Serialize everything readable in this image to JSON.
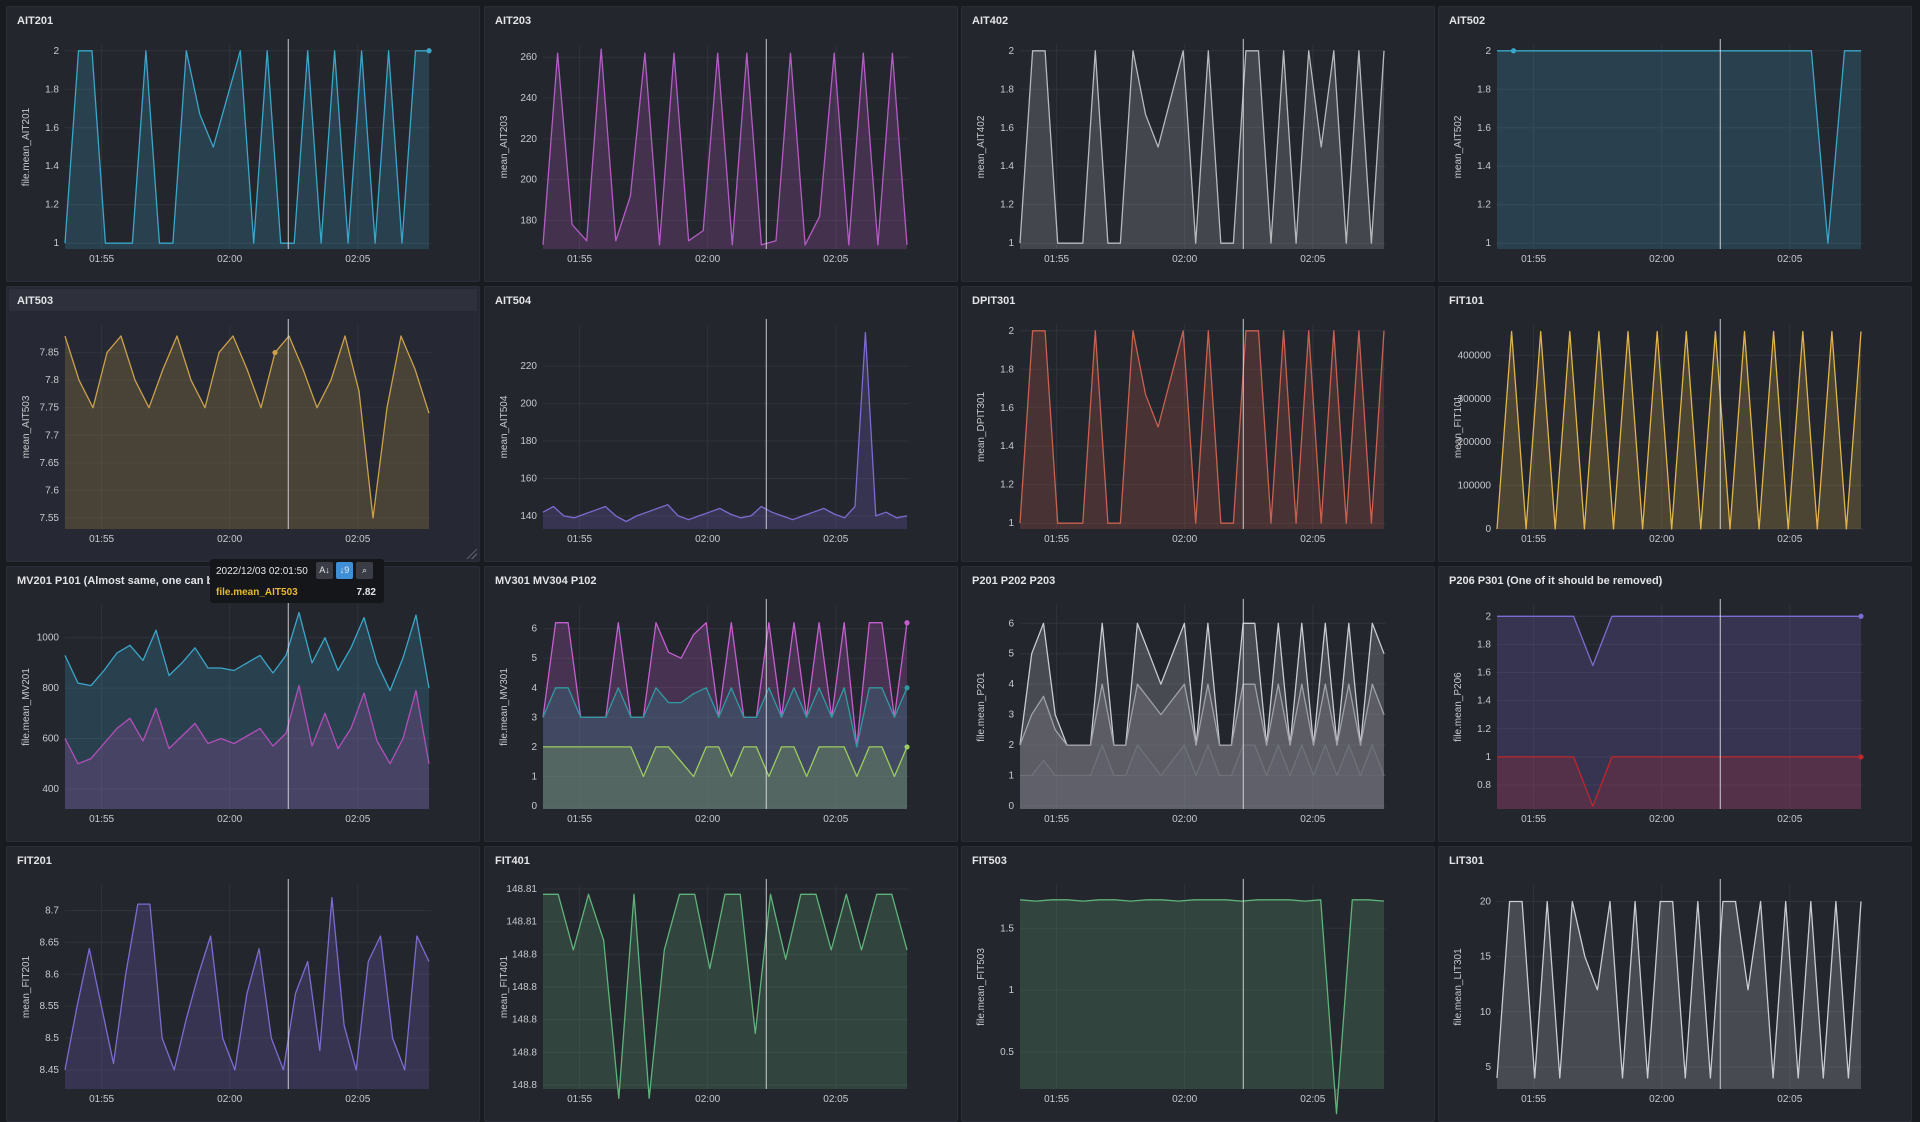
{
  "dashboard": {
    "crosshair_time": "02:02:00"
  },
  "panels": [
    {
      "title": "AIT201",
      "ylabel": "file.mean_AIT201",
      "color": "#3aa6c9",
      "yticks": [
        "2",
        "1.8",
        "1.6",
        "1.4",
        "1.2",
        "1"
      ],
      "xticks": [
        "01:55",
        "02:00",
        "02:05"
      ],
      "series": [
        {
          "values": [
            1,
            2,
            2,
            1,
            1,
            1,
            2,
            1,
            1,
            2,
            1.67,
            1.5,
            1.75,
            2,
            1,
            2,
            1,
            1,
            2,
            1,
            2,
            1,
            2,
            1,
            2,
            1,
            2,
            2
          ]
        }
      ],
      "dot": {
        "series": 0,
        "index": 27
      }
    },
    {
      "title": "AIT203",
      "ylabel": "mean_AIT203",
      "color": "#b45cc4",
      "yticks": [
        "260",
        "240",
        "220",
        "200",
        "180"
      ],
      "xticks": [
        "01:55",
        "02:00",
        "02:05"
      ],
      "series": [
        {
          "values": [
            168,
            262,
            178,
            170,
            264,
            170,
            192,
            262,
            168,
            262,
            170,
            175,
            262,
            168,
            262,
            168,
            170,
            262,
            168,
            182,
            262,
            168,
            262,
            168,
            262,
            168
          ]
        }
      ],
      "ylim": [
        166,
        266
      ]
    },
    {
      "title": "AIT402",
      "ylabel": "mean_AIT402",
      "color": "#b7b9bd",
      "yticks": [
        "2",
        "1.8",
        "1.6",
        "1.4",
        "1.2",
        "1"
      ],
      "xticks": [
        "01:55",
        "02:00",
        "02:05"
      ],
      "series": [
        {
          "values": [
            1,
            2,
            2,
            1,
            1,
            1,
            2,
            1,
            1,
            2,
            1.67,
            1.5,
            1.75,
            2,
            1,
            2,
            1,
            1,
            2,
            2,
            1,
            2,
            1,
            2,
            1.5,
            2,
            1,
            2,
            1,
            2
          ]
        }
      ]
    },
    {
      "title": "AIT502",
      "ylabel": "mean_AIT502",
      "color": "#3aa6c9",
      "yticks": [
        "2",
        "1.8",
        "1.6",
        "1.4",
        "1.2",
        "1"
      ],
      "xticks": [
        "01:55",
        "02:00",
        "02:05"
      ],
      "series": [
        {
          "values": [
            2,
            2,
            2,
            2,
            2,
            2,
            2,
            2,
            2,
            2,
            2,
            2,
            2,
            2,
            2,
            2,
            2,
            2,
            2,
            2,
            1,
            2,
            2
          ]
        }
      ],
      "dot": {
        "series": 0,
        "index": 1
      }
    },
    {
      "title": "AIT503",
      "ylabel": "mean_AIT503",
      "color": "#caa14a",
      "highlight": true,
      "yticks": [
        "7.85",
        "7.8",
        "7.75",
        "7.7",
        "7.65",
        "7.6",
        "7.55"
      ],
      "xticks": [
        "01:55",
        "02:00",
        "02:05"
      ],
      "series": [
        {
          "values": [
            7.88,
            7.8,
            7.75,
            7.85,
            7.88,
            7.8,
            7.75,
            7.82,
            7.88,
            7.8,
            7.75,
            7.85,
            7.88,
            7.82,
            7.75,
            7.85,
            7.88,
            7.82,
            7.75,
            7.8,
            7.88,
            7.78,
            7.55,
            7.75,
            7.88,
            7.82,
            7.74
          ]
        }
      ],
      "dot": {
        "series": 0,
        "index": 15
      },
      "ylim": [
        7.53,
        7.9
      ]
    },
    {
      "title": "AIT504",
      "ylabel": "mean_AIT504",
      "color": "#7c6bd1",
      "yticks": [
        "220",
        "200",
        "180",
        "160",
        "140"
      ],
      "xticks": [
        "01:55",
        "02:00",
        "02:05"
      ],
      "series": [
        {
          "values": [
            142,
            145,
            140,
            139,
            141,
            143,
            145,
            140,
            137,
            140,
            142,
            144,
            146,
            140,
            138,
            140,
            142,
            144,
            141,
            139,
            140,
            145,
            142,
            140,
            138,
            140,
            142,
            144,
            141,
            139,
            145,
            238,
            140,
            142,
            139,
            140
          ]
        }
      ],
      "ylim": [
        133,
        242
      ]
    },
    {
      "title": "DPIT301",
      "ylabel": "mean_DPIT301",
      "color": "#c8614f",
      "yticks": [
        "2",
        "1.8",
        "1.6",
        "1.4",
        "1.2",
        "1"
      ],
      "xticks": [
        "01:55",
        "02:00",
        "02:05"
      ],
      "series": [
        {
          "values": [
            1,
            2,
            2,
            1,
            1,
            1,
            2,
            1,
            1,
            2,
            1.67,
            1.5,
            1.75,
            2,
            1,
            2,
            1,
            1,
            2,
            2,
            1,
            2,
            1,
            2,
            1,
            2,
            1,
            2,
            1,
            2
          ]
        }
      ]
    },
    {
      "title": "FIT101",
      "ylabel": "mean_FIT101",
      "color": "#e0b44a",
      "yticks": [
        "400000",
        "300000",
        "200000",
        "100000",
        "0"
      ],
      "xticks": [
        "01:55",
        "02:00",
        "02:05"
      ],
      "series": [
        {
          "values": [
            0,
            455000,
            0,
            455000,
            0,
            455000,
            0,
            455000,
            0,
            455000,
            0,
            455000,
            0,
            455000,
            0,
            455000,
            0,
            455000,
            0,
            455000,
            0,
            455000,
            0,
            455000,
            0,
            455000
          ]
        }
      ],
      "ylim": [
        0,
        470000
      ]
    },
    {
      "title": "MV201 P101 (Almost same, one can be removed)",
      "ylabel": "file.mean_MV201",
      "colors": [
        "#3aa6c9",
        "#b24fb8"
      ],
      "yticks": [
        "1000",
        "800",
        "600",
        "400"
      ],
      "xticks": [
        "01:55",
        "02:00",
        "02:05"
      ],
      "series": [
        {
          "values": [
            930,
            820,
            810,
            870,
            940,
            970,
            910,
            1030,
            850,
            900,
            960,
            880,
            880,
            870,
            900,
            930,
            860,
            930,
            1100,
            900,
            1000,
            870,
            960,
            1080,
            900,
            790,
            920,
            1090,
            800
          ]
        },
        {
          "values": [
            600,
            500,
            520,
            580,
            640,
            680,
            590,
            720,
            560,
            610,
            660,
            580,
            600,
            580,
            610,
            640,
            570,
            620,
            810,
            570,
            700,
            560,
            640,
            780,
            590,
            500,
            600,
            790,
            500
          ]
        }
      ],
      "ylim": [
        320,
        1130
      ]
    },
    {
      "title": "MV301 MV304 P102",
      "ylabel": "file.mean_MV301",
      "colors": [
        "#c45fd0",
        "#2f9aa0",
        "#9ccc5e"
      ],
      "yticks": [
        "6",
        "5",
        "4",
        "3",
        "2",
        "1",
        "0"
      ],
      "xticks": [
        "01:55",
        "02:00",
        "02:05"
      ],
      "series": [
        {
          "values": [
            3,
            6.2,
            6.2,
            3,
            3,
            3,
            6.2,
            3,
            3,
            6.2,
            5.2,
            5,
            5.8,
            6.2,
            3,
            6.2,
            3,
            3,
            6.2,
            3,
            6.2,
            3,
            6.2,
            3,
            6.2,
            2,
            6.2,
            6.2,
            3,
            6.2
          ]
        },
        {
          "values": [
            3,
            4,
            4,
            3,
            3,
            3,
            4,
            3,
            3,
            4,
            3.5,
            3.5,
            3.8,
            4,
            3,
            4,
            3,
            3,
            4,
            3,
            4,
            3,
            4,
            3,
            4,
            2,
            4,
            4,
            3,
            4
          ]
        },
        {
          "values": [
            2,
            2,
            2,
            2,
            2,
            2,
            2,
            2,
            1,
            2,
            2,
            1.5,
            1,
            2,
            2,
            1,
            2,
            2,
            1,
            2,
            2,
            1,
            2,
            2,
            2,
            1,
            2,
            2,
            1,
            2
          ]
        }
      ],
      "dots": [
        0,
        1,
        2
      ],
      "ylim": [
        -0.1,
        6.8
      ]
    },
    {
      "title": "P201 P202 P203",
      "ylabel": "file.mean_P201",
      "colors": [
        "#c9cbd0",
        "#9ea1a7",
        "#6f7279"
      ],
      "yticks": [
        "6",
        "5",
        "4",
        "3",
        "2",
        "1",
        "0"
      ],
      "xticks": [
        "01:55",
        "02:00",
        "02:05"
      ],
      "series": [
        {
          "values": [
            2,
            5,
            6,
            3,
            2,
            2,
            2,
            6,
            2,
            2,
            6,
            5,
            4,
            5,
            6,
            2,
            6,
            2,
            2,
            6,
            6,
            2,
            6,
            2,
            6,
            2,
            6,
            2,
            6,
            2,
            6,
            5
          ]
        },
        {
          "values": [
            2,
            3,
            3.6,
            2.5,
            2,
            2,
            2,
            4,
            2,
            2,
            4,
            3.5,
            3,
            3.5,
            4,
            2,
            4,
            2,
            2,
            4,
            4,
            2,
            4,
            2,
            4,
            2,
            4,
            2,
            4,
            2,
            4,
            3
          ]
        },
        {
          "values": [
            1,
            1,
            1.5,
            1,
            1,
            1,
            1,
            2,
            1,
            1,
            2,
            1.5,
            1,
            1.5,
            2,
            1,
            2,
            1,
            1,
            2,
            2,
            1,
            2,
            1,
            2,
            1,
            2,
            1,
            2,
            1,
            2,
            1
          ]
        }
      ],
      "ylim": [
        -0.1,
        6.6
      ]
    },
    {
      "title": "P206 P301 (One of it should be removed)",
      "ylabel": "file.mean_P206",
      "colors": [
        "#7c6bd1",
        "#c0262c"
      ],
      "yticks": [
        "2",
        "1.8",
        "1.6",
        "1.4",
        "1.2",
        "1",
        "0.8"
      ],
      "xticks": [
        "01:55",
        "02:00",
        "02:05"
      ],
      "series": [
        {
          "values": [
            2,
            2,
            2,
            2,
            2,
            1.65,
            2,
            2,
            2,
            2,
            2,
            2,
            2,
            2,
            2,
            2,
            2,
            2,
            2,
            2
          ]
        },
        {
          "values": [
            1,
            1,
            1,
            1,
            1,
            0.65,
            1,
            1,
            1,
            1,
            1,
            1,
            1,
            1,
            1,
            1,
            1,
            1,
            1,
            1
          ]
        }
      ],
      "dots": [
        0,
        1
      ],
      "ylim": [
        0.63,
        2.08
      ]
    },
    {
      "title": "FIT201",
      "ylabel": "mean_FIT201",
      "color": "#7c6bd1",
      "yticks": [
        "8.7",
        "8.65",
        "8.6",
        "8.55",
        "8.5",
        "8.45"
      ],
      "xticks": [
        "01:55",
        "02:00",
        "02:05"
      ],
      "series": [
        {
          "values": [
            8.45,
            8.55,
            8.64,
            8.55,
            8.46,
            8.6,
            8.71,
            8.71,
            8.5,
            8.45,
            8.53,
            8.6,
            8.66,
            8.5,
            8.45,
            8.57,
            8.64,
            8.5,
            8.45,
            8.57,
            8.62,
            8.48,
            8.72,
            8.52,
            8.45,
            8.62,
            8.66,
            8.5,
            8.45,
            8.66,
            8.62
          ]
        }
      ],
      "ylim": [
        8.42,
        8.74
      ]
    },
    {
      "title": "FIT401",
      "ylabel": "mean_FIT401",
      "color": "#5fb37a",
      "yticks": [
        "148.81",
        "148.81",
        "148.8",
        "148.8",
        "148.8",
        "148.8",
        "148.8"
      ],
      "xticks": [
        "01:55",
        "02:00",
        "02:05"
      ],
      "series": [
        {
          "values": [
            148.812,
            148.812,
            148.806,
            148.812,
            148.807,
            148.79,
            148.812,
            148.79,
            148.806,
            148.812,
            148.812,
            148.804,
            148.812,
            148.812,
            148.797,
            148.812,
            148.805,
            148.812,
            148.812,
            148.806,
            148.812,
            148.806,
            148.812,
            148.812,
            148.806
          ]
        }
      ],
      "ylim": [
        148.791,
        148.813
      ]
    },
    {
      "title": "FIT503",
      "ylabel": "file.mean_FIT503",
      "color": "#5fb37a",
      "yticks": [
        "1.5",
        "1",
        "0.5"
      ],
      "xticks": [
        "01:55",
        "02:00",
        "02:05"
      ],
      "series": [
        {
          "values": [
            1.73,
            1.72,
            1.73,
            1.73,
            1.72,
            1.73,
            1.73,
            1.72,
            1.73,
            1.73,
            1.72,
            1.73,
            1.73,
            1.73,
            1.72,
            1.73,
            1.73,
            1.73,
            1.72,
            1.73,
            0,
            1.73,
            1.73,
            1.72
          ]
        }
      ],
      "ylim": [
        0.2,
        1.85
      ]
    },
    {
      "title": "LIT301",
      "ylabel": "file.mean_LIT301",
      "color": "#c9cbd0",
      "yticks": [
        "20",
        "15",
        "10",
        "5"
      ],
      "xticks": [
        "01:55",
        "02:00",
        "02:05"
      ],
      "series": [
        {
          "values": [
            4,
            20,
            20,
            4,
            20,
            4,
            20,
            15,
            12,
            20,
            4,
            20,
            4,
            20,
            20,
            4,
            20,
            4,
            20,
            20,
            12,
            20,
            4,
            20,
            4,
            20,
            4,
            20,
            4,
            20
          ]
        }
      ],
      "ylim": [
        3,
        21.5
      ]
    }
  ],
  "tooltip": {
    "time": "2022/12/03 02:01:50",
    "series": "file.mean_AIT503",
    "value": "7.82",
    "series_color": "#e8b931",
    "buttons": [
      "sort-az-icon",
      "sort-numeric-icon",
      "search-icon"
    ]
  }
}
